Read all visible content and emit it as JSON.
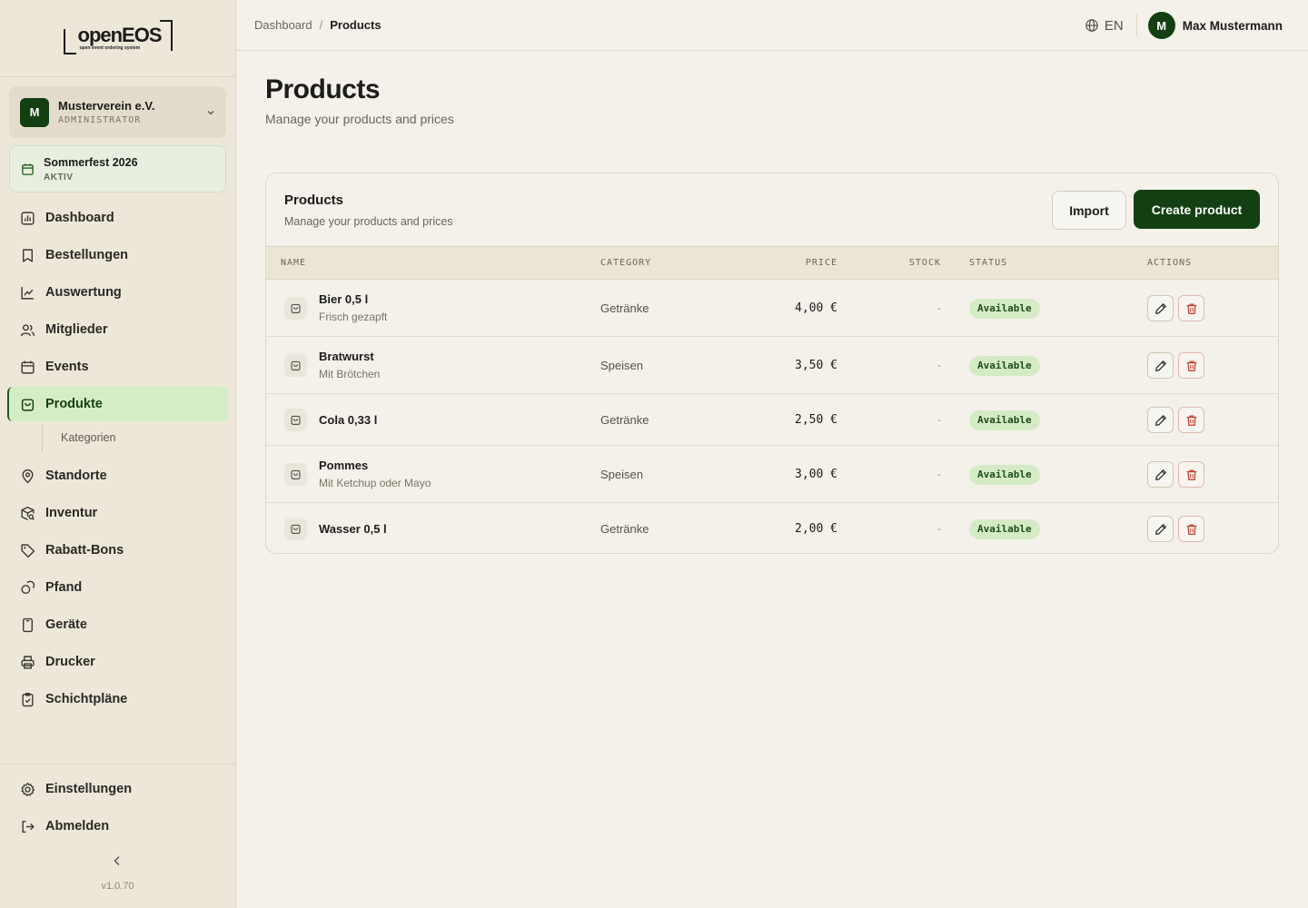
{
  "brand": {
    "logo_text": "openEOS",
    "logo_tagline": "open event ordering system"
  },
  "organization": {
    "avatar": "M",
    "name": "Musterverein e.V.",
    "role": "ADMINISTRATOR"
  },
  "event": {
    "name": "Sommerfest 2026",
    "status": "AKTIV"
  },
  "nav": {
    "items": [
      {
        "label": "Dashboard",
        "icon": "chart-icon"
      },
      {
        "label": "Bestellungen",
        "icon": "receipt-icon"
      },
      {
        "label": "Auswertung",
        "icon": "trend-icon"
      },
      {
        "label": "Mitglieder",
        "icon": "users-icon"
      },
      {
        "label": "Events",
        "icon": "calendar-icon"
      },
      {
        "label": "Produkte",
        "icon": "bag-icon",
        "active": true
      },
      {
        "label": "Standorte",
        "icon": "pin-icon"
      },
      {
        "label": "Inventur",
        "icon": "package-search-icon"
      },
      {
        "label": "Rabatt-Bons",
        "icon": "tag-icon"
      },
      {
        "label": "Pfand",
        "icon": "coins-icon"
      },
      {
        "label": "Geräte",
        "icon": "device-icon"
      },
      {
        "label": "Drucker",
        "icon": "printer-icon"
      },
      {
        "label": "Schichtpläne",
        "icon": "clipboard-check-icon"
      }
    ],
    "sub_items": [
      {
        "label": "Kategorien"
      }
    ]
  },
  "footer_nav": {
    "settings": "Einstellungen",
    "logout": "Abmelden",
    "version": "v1.0.70"
  },
  "breadcrumb": {
    "root": "Dashboard",
    "separator": "/",
    "current": "Products"
  },
  "header": {
    "language": "EN",
    "user_avatar": "M",
    "user_name": "Max Mustermann"
  },
  "page": {
    "title": "Products",
    "subtitle": "Manage your products and prices"
  },
  "card": {
    "title": "Products",
    "subtitle": "Manage your products and prices",
    "import_label": "Import",
    "create_label": "Create product"
  },
  "table": {
    "columns": [
      "NAME",
      "CATEGORY",
      "PRICE",
      "STOCK",
      "STATUS",
      "ACTIONS"
    ],
    "rows": [
      {
        "name": "Bier 0,5 l",
        "description": "Frisch gezapft",
        "category": "Getränke",
        "price": "4,00 €",
        "stock": "-",
        "status": "Available"
      },
      {
        "name": "Bratwurst",
        "description": "Mit Brötchen",
        "category": "Speisen",
        "price": "3,50 €",
        "stock": "-",
        "status": "Available"
      },
      {
        "name": "Cola 0,33 l",
        "description": "",
        "category": "Getränke",
        "price": "2,50 €",
        "stock": "-",
        "status": "Available"
      },
      {
        "name": "Pommes",
        "description": "Mit Ketchup oder Mayo",
        "category": "Speisen",
        "price": "3,00 €",
        "stock": "-",
        "status": "Available"
      },
      {
        "name": "Wasser 0,5 l",
        "description": "",
        "category": "Getränke",
        "price": "2,00 €",
        "stock": "-",
        "status": "Available"
      }
    ]
  },
  "colors": {
    "accent": "#133f12",
    "active_nav_bg": "#d6ecc7",
    "badge_bg": "#d4ebc6",
    "danger": "#c0392b",
    "background": "#f4f1ea",
    "sidebar_bg": "#ede7da"
  }
}
